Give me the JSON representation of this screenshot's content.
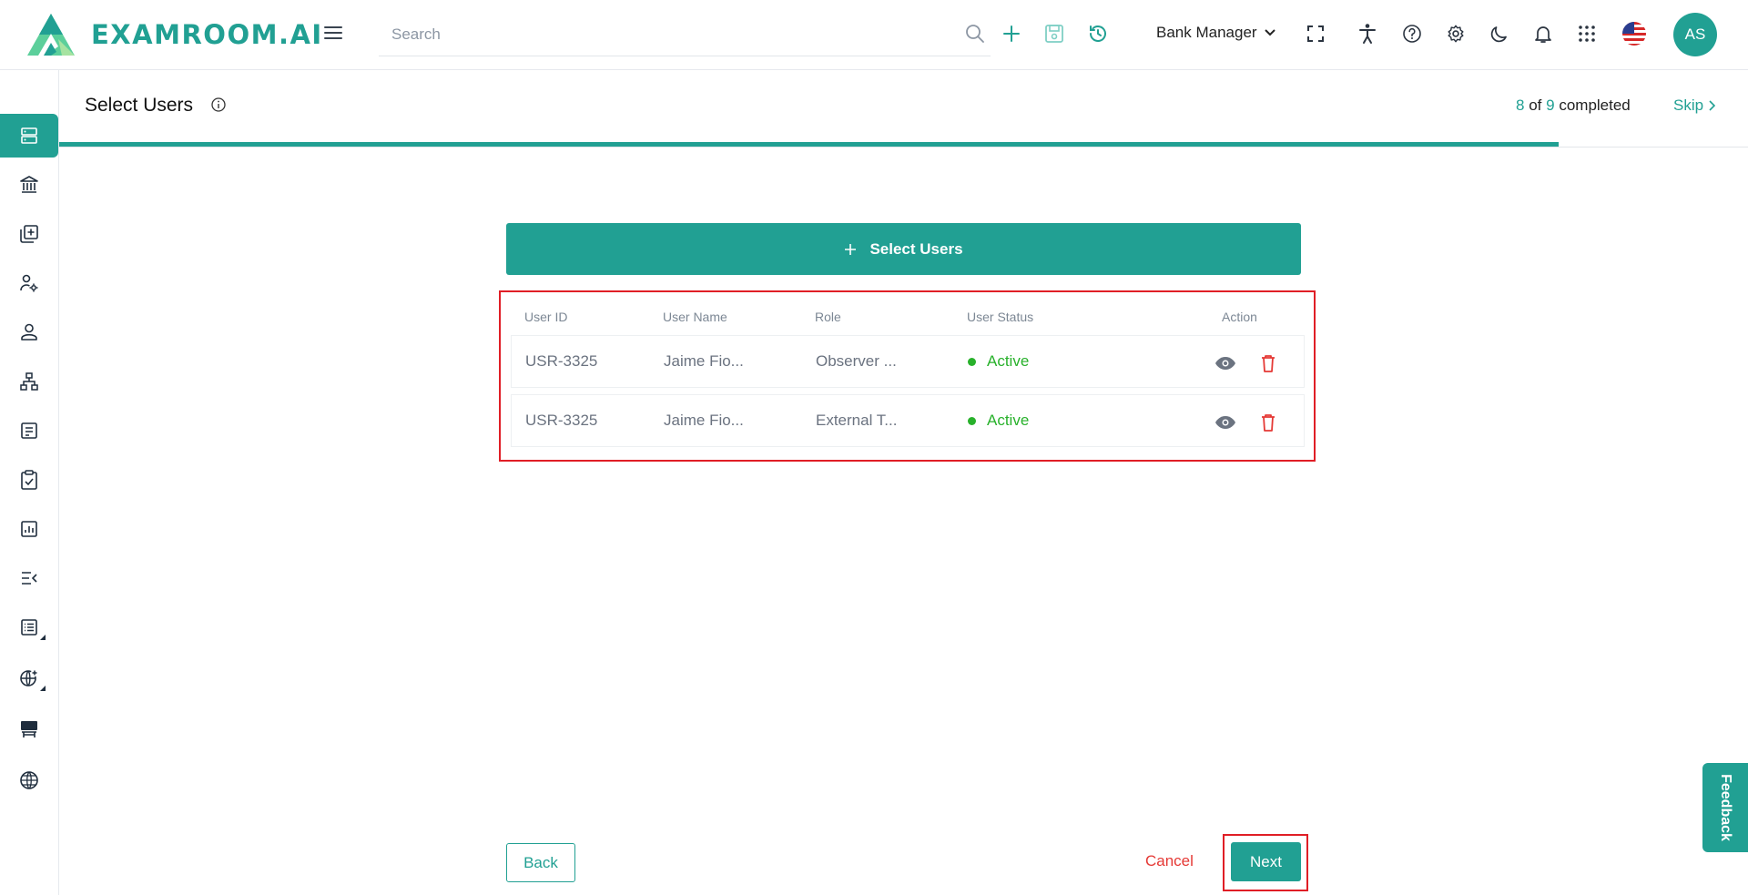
{
  "header": {
    "brand": "EXAMROOM.AI",
    "search_placeholder": "Search",
    "role": "Bank Manager",
    "avatar_initials": "AS"
  },
  "page": {
    "title": "Select Users",
    "progress": {
      "completed": "8",
      "of_word": "of",
      "total": "9",
      "suffix": "completed",
      "fraction": 0.888
    },
    "skip_label": "Skip"
  },
  "select_button_label": "Select Users",
  "table": {
    "headers": [
      "User ID",
      "User Name",
      "Role",
      "User Status",
      "Action"
    ],
    "rows": [
      {
        "user_id": "USR-3325",
        "user_name": "Jaime Fio...",
        "role": "Observer ...",
        "status": "Active"
      },
      {
        "user_id": "USR-3325",
        "user_name": "Jaime Fio...",
        "role": "External T...",
        "status": "Active"
      }
    ]
  },
  "footer": {
    "back_label": "Back",
    "cancel_label": "Cancel",
    "next_label": "Next"
  },
  "feedback_label": "Feedback",
  "colors": {
    "accent": "#21a093",
    "danger": "#e53935",
    "success": "#28b12b",
    "highlight": "#e01e26"
  },
  "sidebar_icons": [
    "server-icon",
    "bank-icon",
    "add-library-icon",
    "user-settings-icon",
    "user-icon",
    "hierarchy-icon",
    "form-icon",
    "clipboard-check-icon",
    "report-chart-icon",
    "collapse-list-icon",
    "list-icon",
    "globe-add-icon",
    "desk-icon",
    "globe-icon"
  ]
}
